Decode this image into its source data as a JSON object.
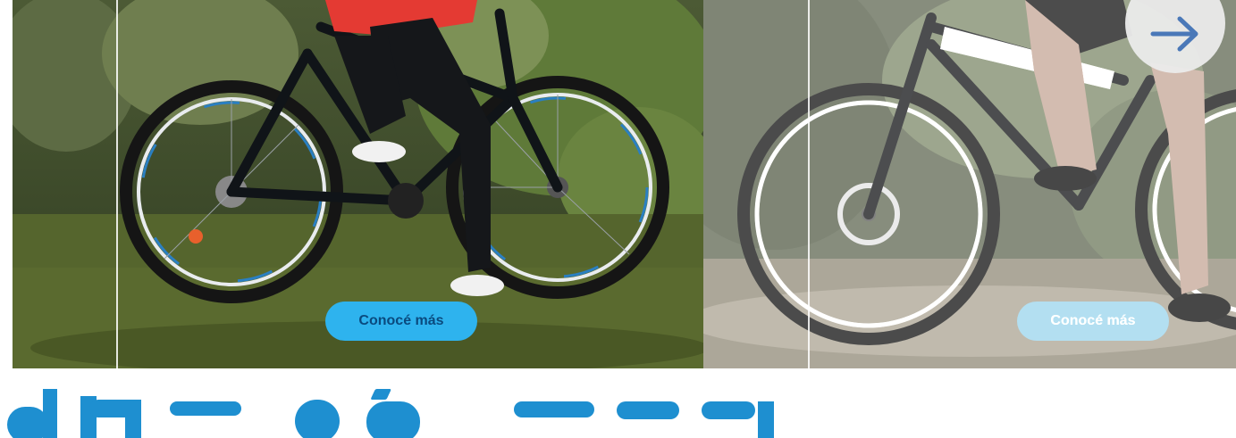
{
  "carousel": {
    "slides": [
      {
        "cta_label": "Conocé más"
      },
      {
        "cta_label": "Conocé más"
      }
    ],
    "next_icon": "arrow-right-icon"
  },
  "headline": {
    "text": ""
  },
  "colors": {
    "cta_blue": "#2eb3ee",
    "cta_text": "#0a4a7e",
    "headline_blue": "#1e8fd0",
    "arrow_blue": "#4a78b8"
  }
}
